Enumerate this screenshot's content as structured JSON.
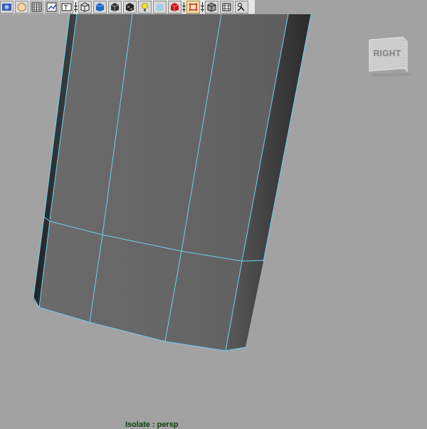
{
  "viewport": {
    "background": "#a2a2a2",
    "mesh_fill": "#676767",
    "wire_color": "#6fd2ee"
  },
  "toolbar": {
    "items": [
      {
        "type": "button",
        "icon": "camera-attributes-icon"
      },
      {
        "type": "button",
        "icon": "image-plane-icon"
      },
      {
        "type": "button",
        "icon": "grid-icon"
      },
      {
        "type": "button",
        "icon": "film-gate-icon"
      },
      {
        "type": "button",
        "icon": "resolution-gate-icon"
      },
      {
        "type": "separator"
      },
      {
        "type": "button",
        "icon": "wireframe-icon"
      },
      {
        "type": "button",
        "icon": "smooth-shade-icon"
      },
      {
        "type": "button",
        "icon": "wireframe-on-shaded-icon"
      },
      {
        "type": "button",
        "icon": "textured-icon"
      },
      {
        "type": "button",
        "icon": "use-all-lights-icon"
      },
      {
        "type": "button",
        "icon": "shadows-icon"
      },
      {
        "type": "button",
        "icon": "xray-icon"
      },
      {
        "type": "separator"
      },
      {
        "type": "button",
        "icon": "isolate-select-icon",
        "active": true
      },
      {
        "type": "separator"
      },
      {
        "type": "button",
        "icon": "xray-joints-icon"
      },
      {
        "type": "button",
        "icon": "xray-components-icon"
      },
      {
        "type": "button",
        "icon": "camera-pan-zoom-icon"
      }
    ]
  },
  "viewcube": {
    "label": "RIGHT"
  },
  "hud": {
    "isolate_text": "Isolate : persp"
  }
}
